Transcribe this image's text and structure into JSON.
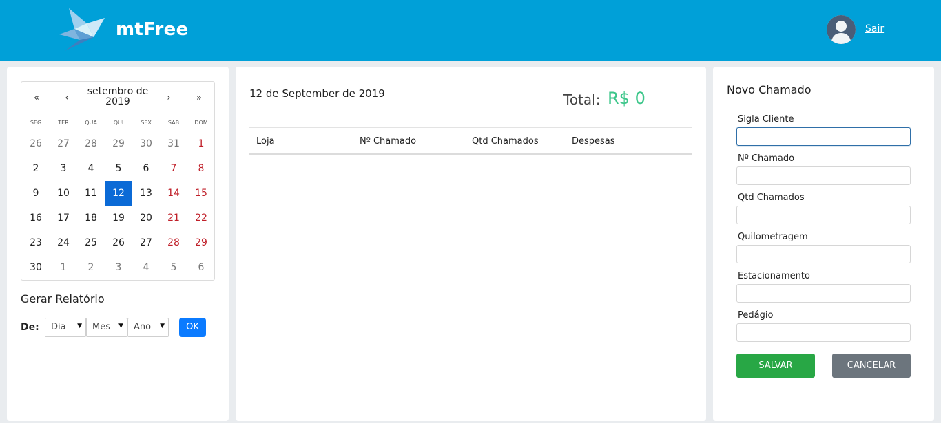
{
  "header": {
    "brand": "mtFree",
    "logout_label": "Sair",
    "colors": {
      "bar": "#00a0d8"
    }
  },
  "calendar": {
    "month_title": "setembro de 2019",
    "nav": {
      "prev_year": "«",
      "prev_month": "‹",
      "next_month": "›",
      "next_year": "»"
    },
    "weekdays": [
      "SEG",
      "TER",
      "QUA",
      "QUI",
      "SEX",
      "SAB",
      "DOM"
    ],
    "weeks": [
      [
        "26",
        "27",
        "28",
        "29",
        "30",
        "31",
        "1"
      ],
      [
        "2",
        "3",
        "4",
        "5",
        "6",
        "7",
        "8"
      ],
      [
        "9",
        "10",
        "11",
        "12",
        "13",
        "14",
        "15"
      ],
      [
        "16",
        "17",
        "18",
        "19",
        "20",
        "21",
        "22"
      ],
      [
        "23",
        "24",
        "25",
        "26",
        "27",
        "28",
        "29"
      ],
      [
        "30",
        "1",
        "2",
        "3",
        "4",
        "5",
        "6"
      ]
    ],
    "selected_day": "12",
    "colors": {
      "selected": "#0b6ad6",
      "weekend": "#c0202a"
    }
  },
  "report": {
    "title": "Gerar Relatório",
    "from_label": "De:",
    "day_select": "Dia",
    "month_select": "Mes",
    "year_select": "Ano",
    "ok_label": "OK"
  },
  "main": {
    "date_title": "12 de September de 2019",
    "total_label": "Total:",
    "total_value": "R$ 0",
    "columns": [
      "Loja",
      "Nº Chamado",
      "Qtd Chamados",
      "Despesas"
    ],
    "colors": {
      "total": "#3cc68a"
    }
  },
  "form": {
    "title": "Novo Chamado",
    "fields": [
      {
        "label": "Sigla Cliente",
        "value": ""
      },
      {
        "label": "Nº Chamado",
        "value": ""
      },
      {
        "label": "Qtd Chamados",
        "value": ""
      },
      {
        "label": "Quilometragem",
        "value": ""
      },
      {
        "label": "Estacionamento",
        "value": ""
      },
      {
        "label": "Pedágio",
        "value": ""
      }
    ],
    "save_label": "SALVAR",
    "cancel_label": "CANCELAR",
    "colors": {
      "save": "#28a745",
      "cancel": "#6c757d"
    }
  }
}
